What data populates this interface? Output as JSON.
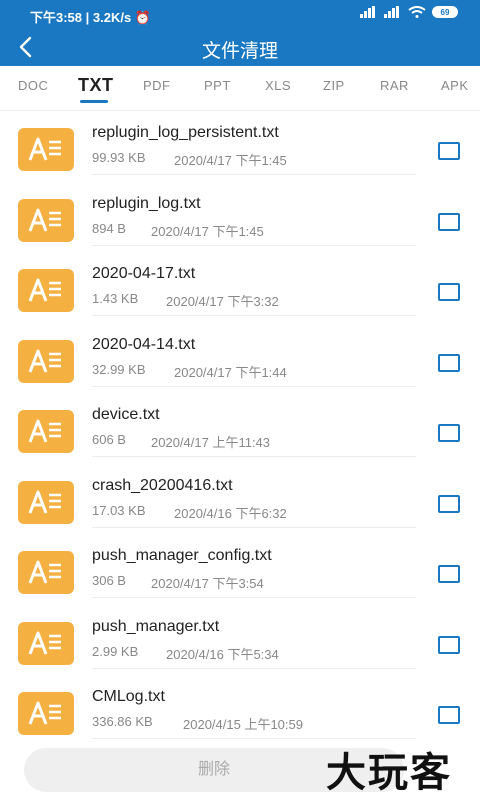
{
  "status": {
    "time_speed": "下午3:58 | 3.2K/s ⏰",
    "battery": "69"
  },
  "header": {
    "title": "文件清理"
  },
  "tabs": [
    "DOC",
    "TXT",
    "PDF",
    "PPT",
    "XLS",
    "ZIP",
    "RAR",
    "APK"
  ],
  "active_tab": "TXT",
  "files": [
    {
      "name": "replugin_log_persistent.txt",
      "size": "99.93 KB",
      "date": "2020/4/17 下午1:45"
    },
    {
      "name": "replugin_log.txt",
      "size": "894 B",
      "date": "2020/4/17 下午1:45"
    },
    {
      "name": "2020-04-17.txt",
      "size": "1.43 KB",
      "date": "2020/4/17 下午3:32"
    },
    {
      "name": "2020-04-14.txt",
      "size": "32.99 KB",
      "date": "2020/4/17 下午1:44"
    },
    {
      "name": "device.txt",
      "size": "606 B",
      "date": "2020/4/17 上午11:43"
    },
    {
      "name": "crash_20200416.txt",
      "size": "17.03 KB",
      "date": "2020/4/16 下午6:32"
    },
    {
      "name": "push_manager_config.txt",
      "size": "306 B",
      "date": "2020/4/17 下午3:54"
    },
    {
      "name": "push_manager.txt",
      "size": "2.99 KB",
      "date": "2020/4/16 下午5:34"
    },
    {
      "name": "CMLog.txt",
      "size": "336.86 KB",
      "date": "2020/4/15 上午10:59"
    }
  ],
  "delete_label": "删除",
  "watermark": "大玩客",
  "colors": {
    "primary": "#1a78c2",
    "file_icon": "#f5b042"
  }
}
